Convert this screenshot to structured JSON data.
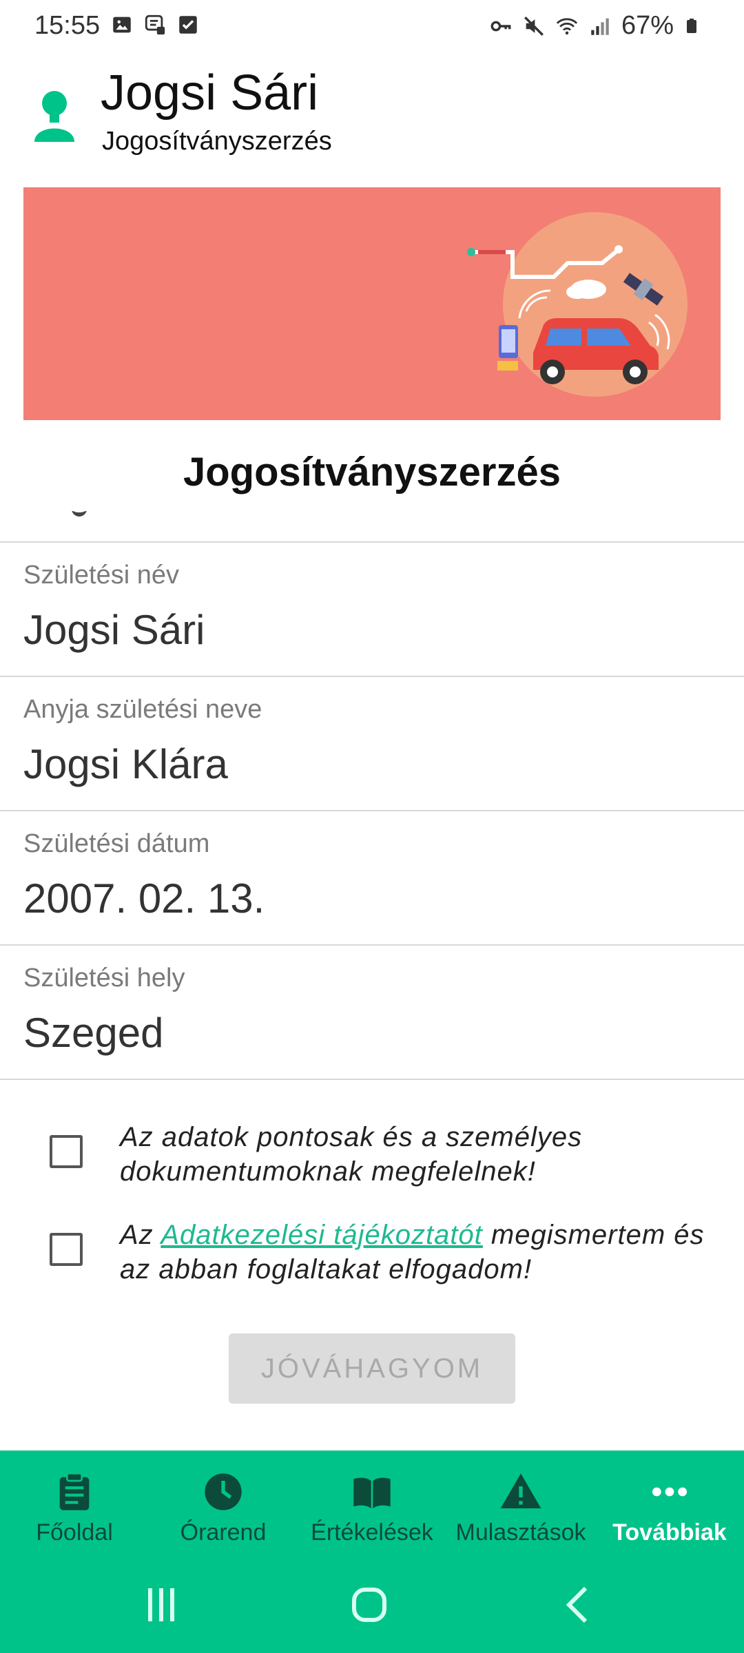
{
  "status_bar": {
    "time": "15:55",
    "battery": "67%",
    "left_icons": [
      "gallery-icon",
      "message-icon",
      "check-box-icon"
    ],
    "right_icons": [
      "key-icon",
      "mute-icon",
      "wifi-icon",
      "signal-icon",
      "battery-icon"
    ]
  },
  "header": {
    "user_name": "Jogsi Sári",
    "subtitle": "Jogosítványszerzés"
  },
  "colors": {
    "brand_green": "#00c38a",
    "banner_red": "#f27e74",
    "link_green": "#1db990"
  },
  "section_title": "Jogosítványszerzés",
  "form": {
    "rows": [
      {
        "label": "Születési név",
        "value": "Jogsi Sári"
      },
      {
        "label": "Anyja születési neve",
        "value": "Jogsi Klára"
      },
      {
        "label": "Születési dátum",
        "value": "2007. 02. 13."
      },
      {
        "label": "Születési hely",
        "value": "Szeged"
      }
    ]
  },
  "checks": {
    "accuracy": {
      "text": "Az adatok pontosak és a személyes dokumentumoknak megfelelnek!",
      "checked": false
    },
    "privacy": {
      "prefix": "Az ",
      "link": "Adatkezelési tájékoztatót",
      "suffix": " megismertem és az abban foglaltakat elfogadom!",
      "checked": false
    }
  },
  "approve_button": {
    "label": "JÓVÁHAGYOM",
    "enabled": false
  },
  "bottom_nav": {
    "items": [
      {
        "label": "Főoldal",
        "icon": "clipboard-icon",
        "active": false
      },
      {
        "label": "Órarend",
        "icon": "clock-icon",
        "active": false
      },
      {
        "label": "Értékelések",
        "icon": "book-icon",
        "active": false
      },
      {
        "label": "Mulasztások",
        "icon": "warning-icon",
        "active": false
      },
      {
        "label": "Továbbiak",
        "icon": "more-icon",
        "active": true
      }
    ]
  },
  "system_nav": [
    "recents-button",
    "home-button",
    "back-button"
  ]
}
